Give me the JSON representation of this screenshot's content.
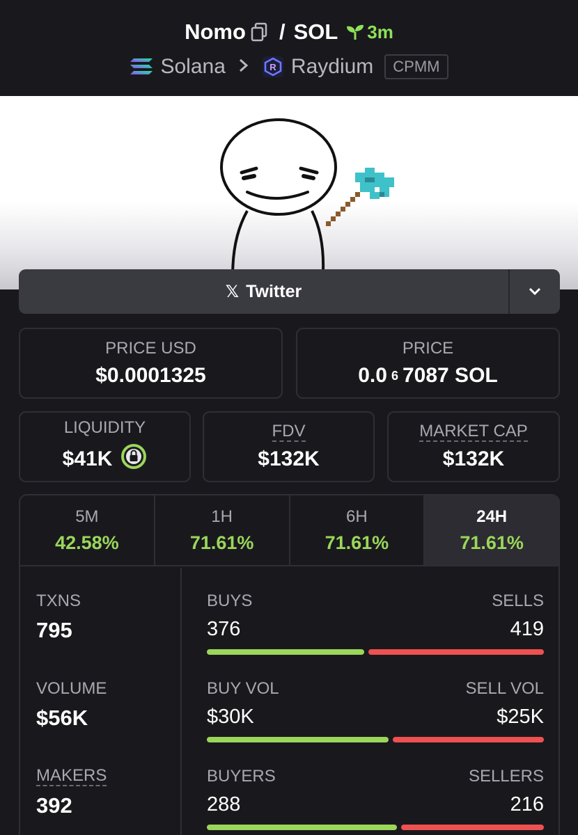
{
  "header": {
    "token_symbol": "Nomo",
    "separator": "/",
    "quote_symbol": "SOL",
    "age": "3m",
    "chain": "Solana",
    "dex": "Raydium",
    "pool_type": "CPMM",
    "icons": {
      "copy": "copy-icon",
      "age": "seedling-icon",
      "chain": "solana-logo",
      "dex": "raydium-logo",
      "chevron": "chevron-right-icon"
    }
  },
  "banner": {
    "image": "cartoon stick figure holding pixel axe",
    "colors": {
      "background": "#ffffff",
      "axe_head": "#3fc1c9",
      "axe_handle": "#8a5a2b"
    }
  },
  "social": {
    "twitter_label": "Twitter",
    "x_glyph": "𝕏",
    "dropdown_icon": "chevron-down-icon"
  },
  "prices": {
    "usd_label": "PRICE USD",
    "usd_value": "$0.0001325",
    "native_label": "PRICE",
    "native_prefix": "0.0",
    "native_zeros": "6",
    "native_suffix": "7087 SOL"
  },
  "metrics": {
    "liquidity_label": "LIQUIDITY",
    "liquidity_value": "$41K",
    "liquidity_icon": "lock-icon",
    "fdv_label": "FDV",
    "fdv_value": "$132K",
    "mcap_label": "MARKET CAP",
    "mcap_value": "$132K"
  },
  "timeframes": [
    {
      "label": "5M",
      "change": "42.58%"
    },
    {
      "label": "1H",
      "change": "71.61%"
    },
    {
      "label": "6H",
      "change": "71.61%"
    },
    {
      "label": "24H",
      "change": "71.61%",
      "active": true
    }
  ],
  "stats": {
    "txns_label": "TXNS",
    "txns_value": "795",
    "volume_label": "VOLUME",
    "volume_value": "$56K",
    "makers_label": "MAKERS",
    "makers_value": "392",
    "buys_label": "BUYS",
    "buys_value": "376",
    "sells_label": "SELLS",
    "sells_value": "419",
    "buys_ratio": 0.473,
    "buy_vol_label": "BUY VOL",
    "buy_vol_value": "$30K",
    "sell_vol_label": "SELL VOL",
    "sell_vol_value": "$25K",
    "vol_ratio": 0.545,
    "buyers_label": "BUYERS",
    "buyers_value": "288",
    "sellers_label": "SELLERS",
    "sellers_value": "216",
    "makers_ratio": 0.571
  },
  "colors": {
    "positive": "#9bd65a",
    "negative": "#ef5050",
    "background": "#19191d"
  }
}
